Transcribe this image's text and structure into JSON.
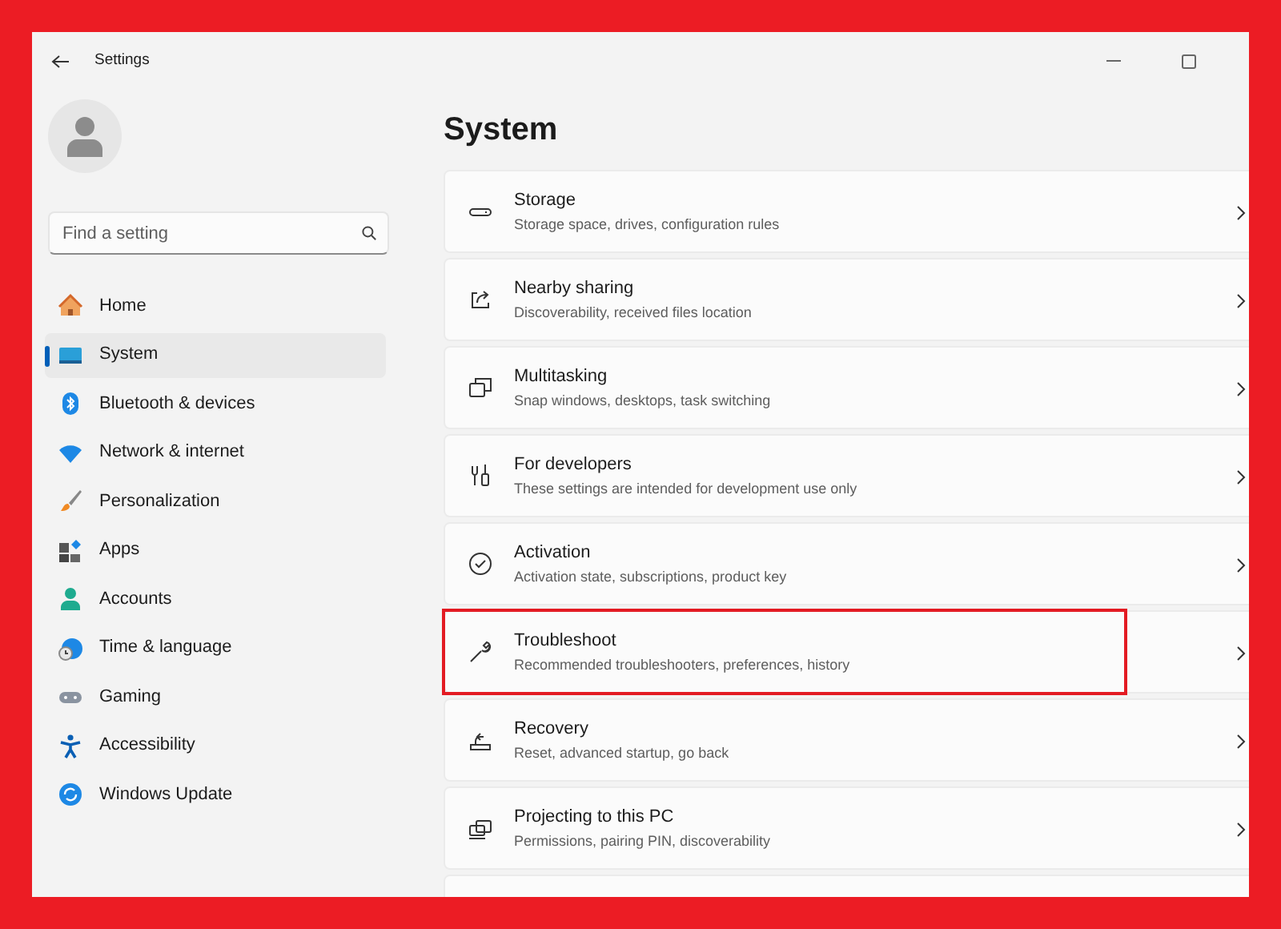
{
  "window": {
    "title": "Settings"
  },
  "sidebar": {
    "search": {
      "placeholder": "Find a setting"
    },
    "items": [
      {
        "label": "Home",
        "selected": false
      },
      {
        "label": "System",
        "selected": true
      },
      {
        "label": "Bluetooth & devices",
        "selected": false
      },
      {
        "label": "Network & internet",
        "selected": false
      },
      {
        "label": "Personalization",
        "selected": false
      },
      {
        "label": "Apps",
        "selected": false
      },
      {
        "label": "Accounts",
        "selected": false
      },
      {
        "label": "Time & language",
        "selected": false
      },
      {
        "label": "Gaming",
        "selected": false
      },
      {
        "label": "Accessibility",
        "selected": false
      },
      {
        "label": "Windows Update",
        "selected": false
      }
    ]
  },
  "page": {
    "title": "System",
    "cards": [
      {
        "title": "Storage",
        "subtitle": "Storage space, drives, configuration rules",
        "highlighted": false
      },
      {
        "title": "Nearby sharing",
        "subtitle": "Discoverability, received files location",
        "highlighted": false
      },
      {
        "title": "Multitasking",
        "subtitle": "Snap windows, desktops, task switching",
        "highlighted": false
      },
      {
        "title": "For developers",
        "subtitle": "These settings are intended for development use only",
        "highlighted": false
      },
      {
        "title": "Activation",
        "subtitle": "Activation state, subscriptions, product key",
        "highlighted": false
      },
      {
        "title": "Troubleshoot",
        "subtitle": "Recommended troubleshooters, preferences, history",
        "highlighted": true
      },
      {
        "title": "Recovery",
        "subtitle": "Reset, advanced startup, go back",
        "highlighted": false
      },
      {
        "title": "Projecting to this PC",
        "subtitle": "Permissions, pairing PIN, discoverability",
        "highlighted": false
      }
    ]
  }
}
